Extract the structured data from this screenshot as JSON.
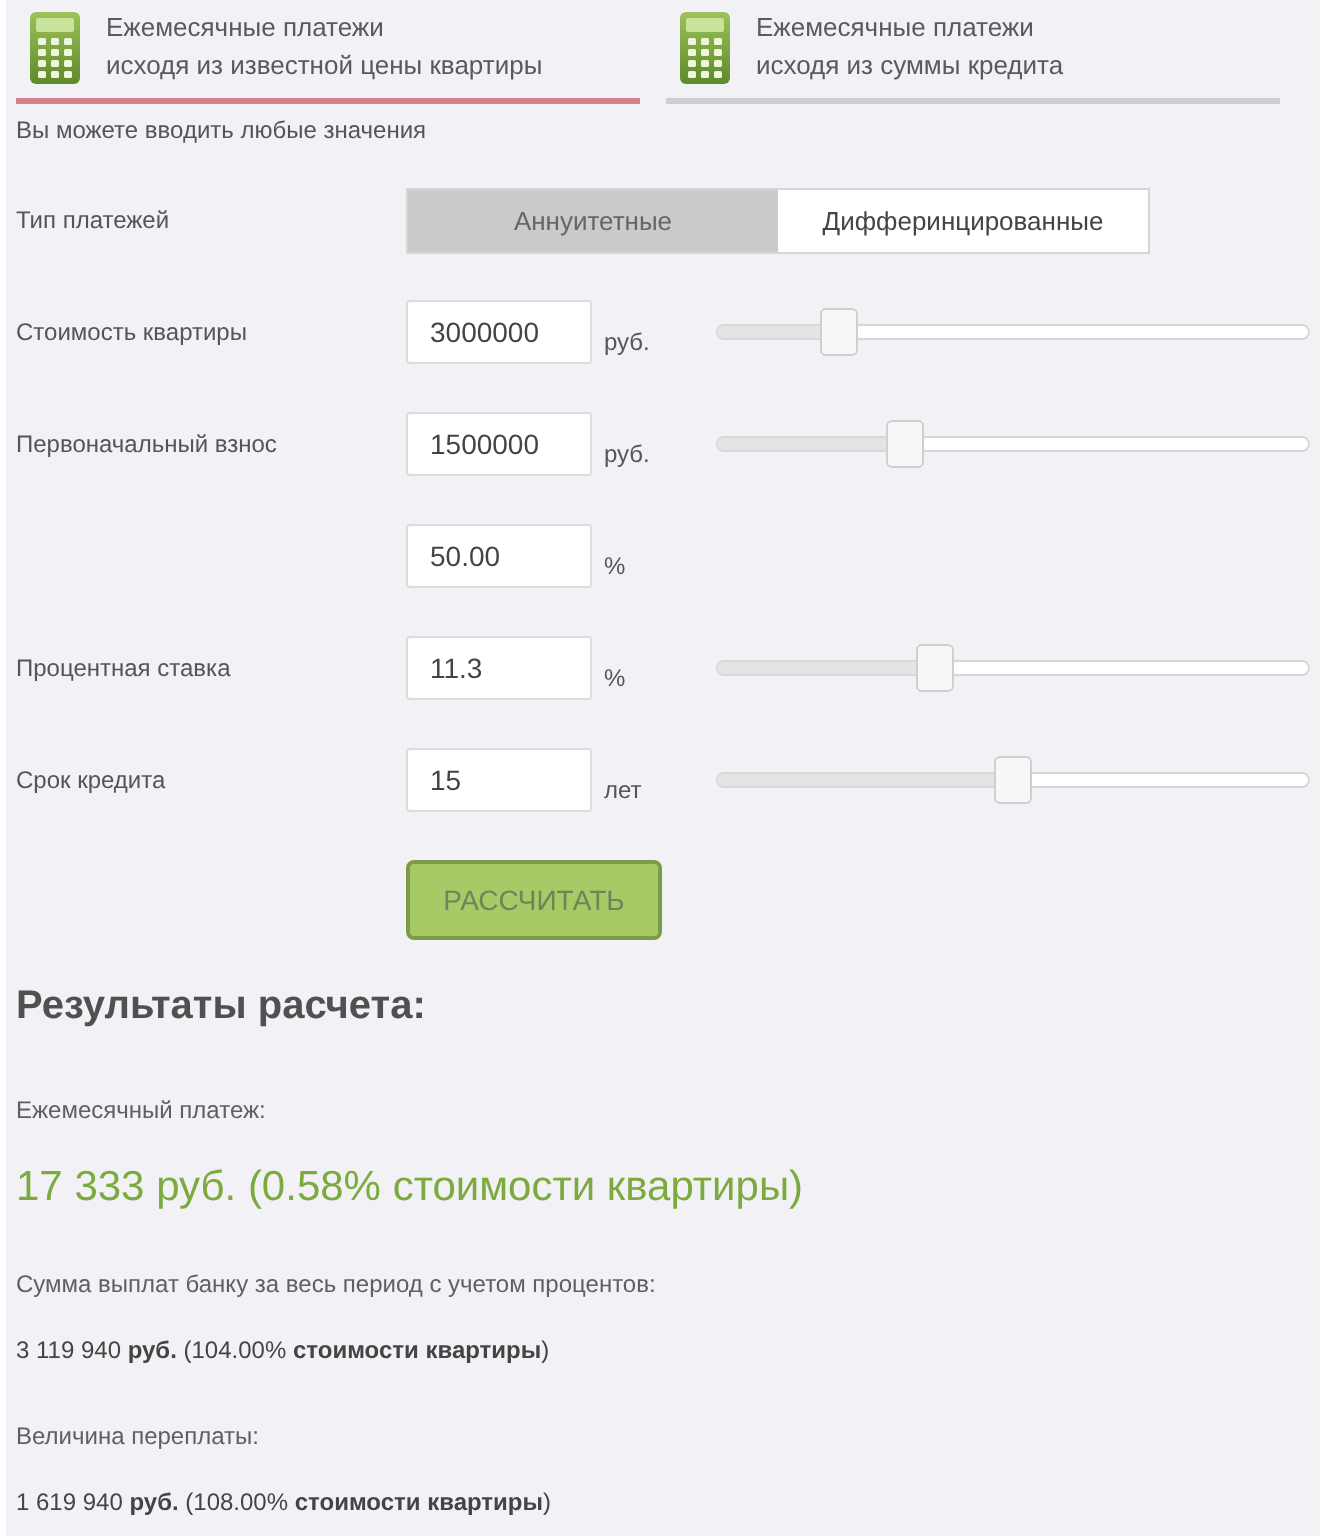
{
  "tabs": [
    {
      "lines": [
        "Ежемесячные платежи",
        "исходя из известной цены квартиры"
      ],
      "selected": true
    },
    {
      "lines": [
        "Ежемесячные платежи",
        "исходя из суммы кредита"
      ],
      "selected": false
    }
  ],
  "hint": "Вы можете вводить любые значения",
  "payment_type": {
    "label": "Тип платежей",
    "options": [
      {
        "label": "Аннуитетные",
        "selected": true
      },
      {
        "label": "Дифферинцированные",
        "selected": false
      }
    ]
  },
  "fields": [
    {
      "label": "Стоимость квартиры",
      "value": "3000000",
      "unit": "руб.",
      "slider": {
        "level": 0.21
      }
    },
    {
      "label": "Первоначальный взнос",
      "value": "1500000",
      "unit": "руб.",
      "slider": {
        "level": 0.32
      }
    },
    {
      "value": "50.00",
      "unit": "%"
    },
    {
      "label": "Процентная ставка",
      "value": "11.3",
      "unit": "%",
      "slider": {
        "level": 0.37
      }
    },
    {
      "label": "Срок кредита",
      "value": "15",
      "unit": "лет",
      "slider": {
        "level": 0.5
      }
    }
  ],
  "calculate_button": "РАССЧИТАТЬ",
  "results": {
    "title": "Результаты расчета:",
    "items": [
      {
        "kind": "highlight",
        "label": "Ежемесячный платеж:",
        "value": "17 333 руб. (0.58% стоимости квартиры)"
      },
      {
        "kind": "plain",
        "label": "Сумма выплат банку за весь период с учетом процентов:",
        "value": "3 119 940 **руб.** (104.00% **стоимости квартиры**)"
      },
      {
        "kind": "plain",
        "label": "Величина переплаты:",
        "value": "1 619 940 **руб.** (108.00% **стоимости квартиры**)"
      }
    ]
  }
}
